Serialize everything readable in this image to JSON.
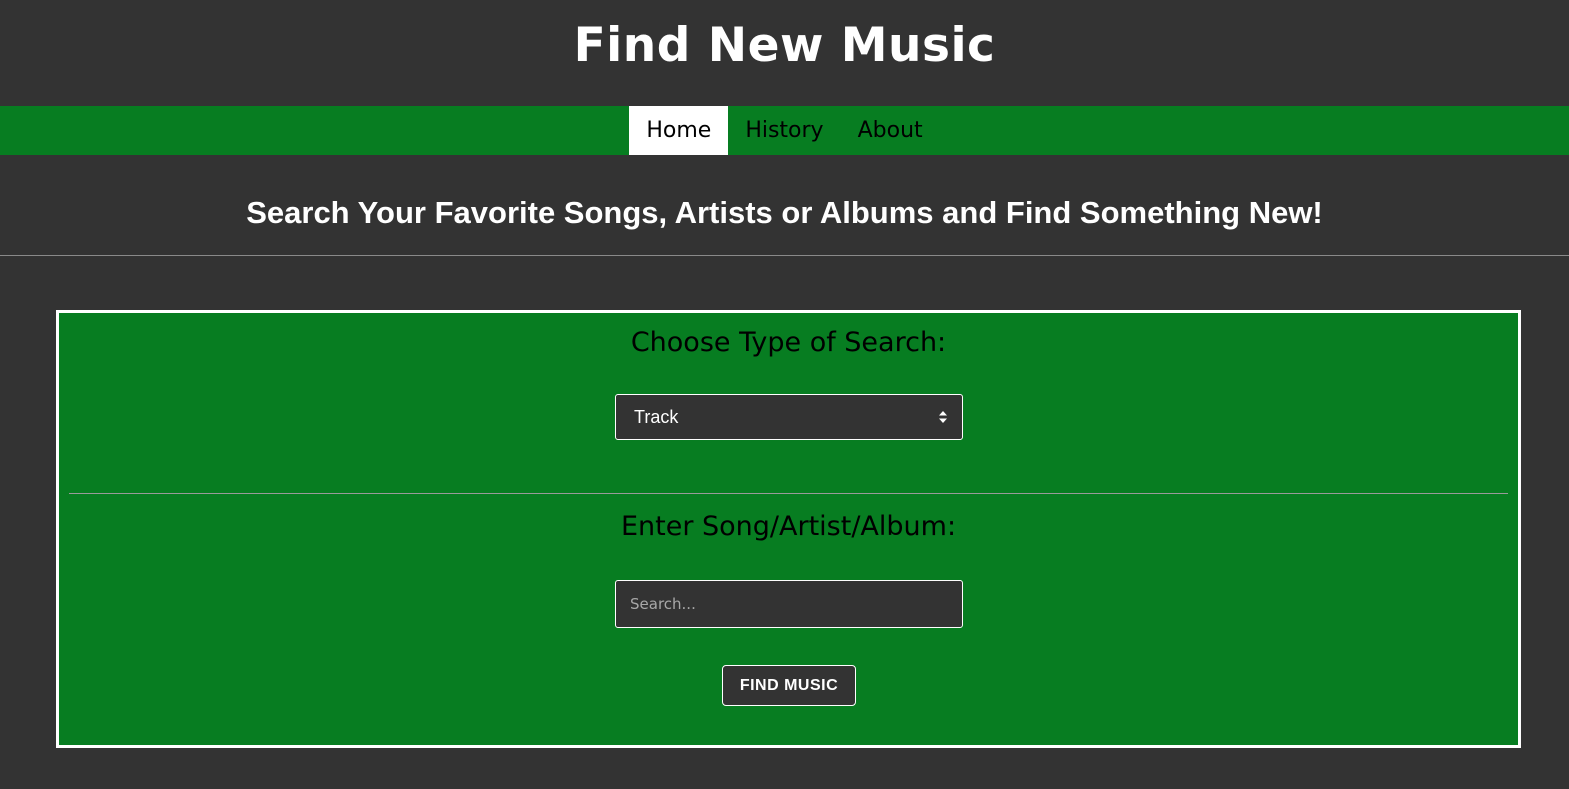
{
  "header": {
    "title": "Find New Music"
  },
  "nav": {
    "items": [
      {
        "label": "Home",
        "active": true
      },
      {
        "label": "History",
        "active": false
      },
      {
        "label": "About",
        "active": false
      }
    ]
  },
  "tagline": "Search Your Favorite Songs, Artists or Albums and Find Something New!",
  "search_panel": {
    "type_label": "Choose Type of Search:",
    "type_select": {
      "selected": "Track",
      "icon": "select-arrows-icon"
    },
    "query_label": "Enter Song/Artist/Album:",
    "query_input": {
      "value": "",
      "placeholder": "Search..."
    },
    "submit_label": "FIND MUSIC"
  },
  "colors": {
    "background": "#333333",
    "accent_green": "#077d21",
    "text_light": "#ffffff",
    "text_dark": "#000000"
  }
}
